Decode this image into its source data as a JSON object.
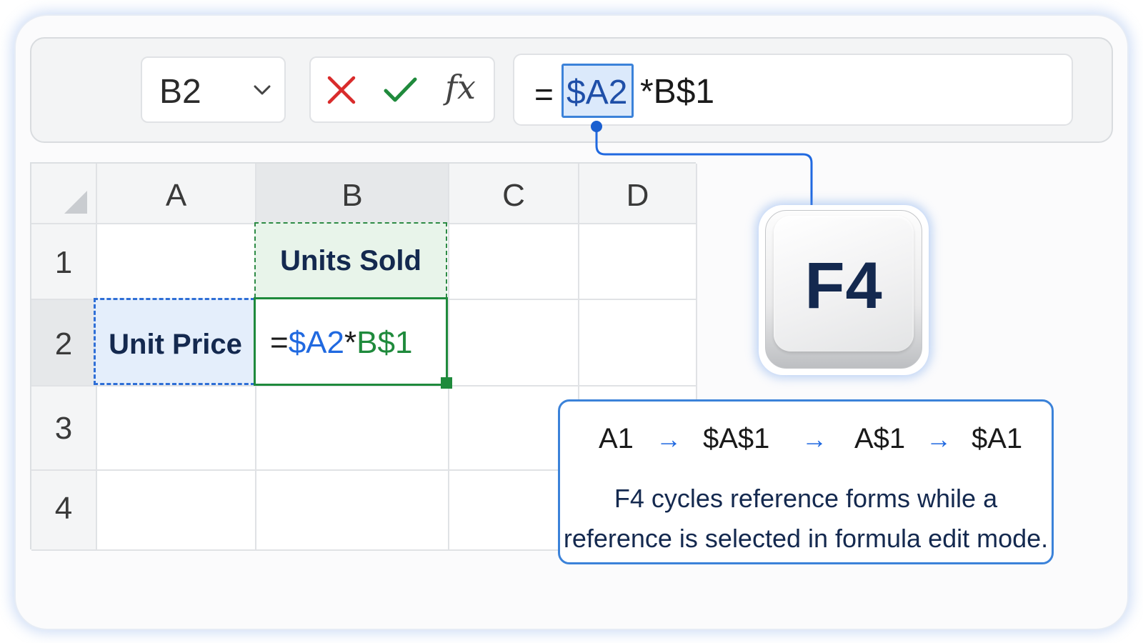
{
  "formula_bar": {
    "name_box": "B2",
    "fx_label": "fx",
    "formula_equals": "=",
    "formula_selected_ref": "$A2",
    "formula_rest": "*B$1"
  },
  "grid": {
    "columns": [
      "A",
      "B",
      "C",
      "D"
    ],
    "rows": [
      "1",
      "2",
      "3",
      "4"
    ],
    "cells": {
      "B1": "Units Sold",
      "A2": "Unit Price",
      "B2": {
        "eq": "=",
        "ref_a": "$A2",
        "op": "*",
        "ref_b": "B$1"
      }
    }
  },
  "key": {
    "label": "F4"
  },
  "info": {
    "cycle": [
      "A1",
      "$A$1",
      "A$1",
      "$A1"
    ],
    "arrow": "→",
    "text_line1": "F4 cycles reference forms while a",
    "text_line2": "reference is selected in formula edit mode."
  },
  "colors": {
    "accent_blue": "#2069e0",
    "accent_green": "#1f8a3c",
    "cancel_red": "#d92b2b",
    "heading_navy": "#14294f"
  }
}
